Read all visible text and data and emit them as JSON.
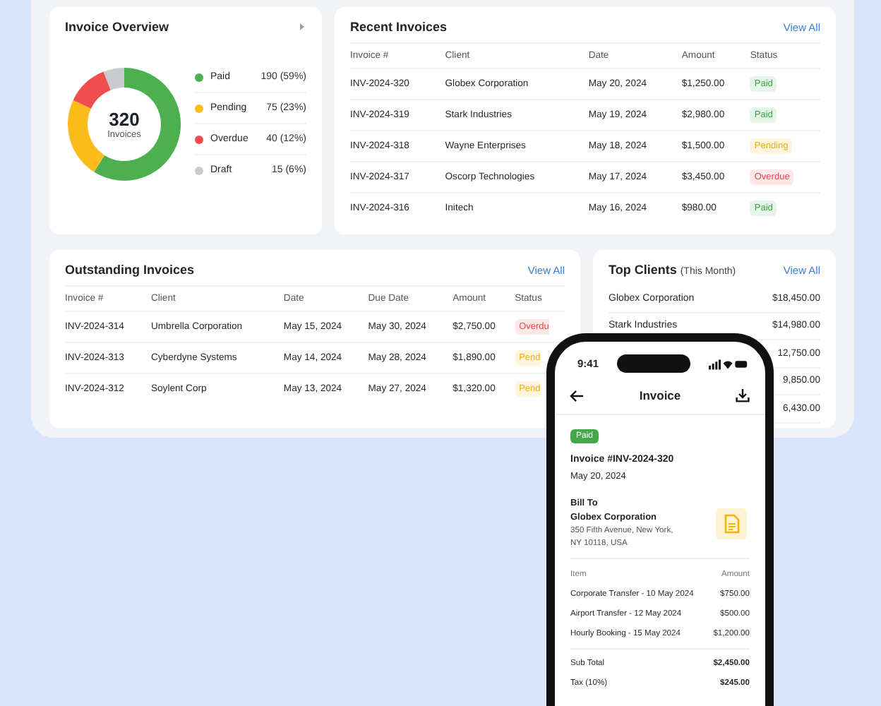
{
  "overview": {
    "title": "Invoice Overview",
    "total": "320",
    "total_label": "Invoices",
    "legend": [
      {
        "value": "190 (59%)",
        "color": "#4caf50"
      },
      {
        "value": "75 (23%)",
        "color": "#fbbc1a"
      },
      {
        "value": "40 (12%)",
        "color": "#f04e4e"
      },
      {
        "value": "15 (6%)",
        "color": "#c8cacd"
      }
    ],
    "chart_data": {
      "type": "donut",
      "categories": [
        "Paid",
        "Pending",
        "Overdue",
        "Draft"
      ],
      "values": [
        59,
        23,
        12,
        6
      ]
    }
  },
  "recent": {
    "title": "Recent Invoices",
    "link": "View All",
    "columns": [
      "Invoice #",
      "Client",
      "Date",
      "Amount",
      "Status"
    ],
    "rows": [
      {
        "invoice": "INV-2024-320",
        "client": "Globex Corporation",
        "date": "May 20, 2024",
        "amount": "$1,250.00",
        "status": {
          "label": "Paid",
          "kind": "paid"
        }
      },
      {
        "invoice": "INV-2024-319",
        "client": "Stark Industries",
        "date": "May 19, 2024",
        "amount": "$2,980.00",
        "status": {
          "label": "Paid",
          "kind": "paid"
        }
      },
      {
        "invoice": "INV-2024-318",
        "client": "Wayne Enterprises",
        "date": "May 18, 2024",
        "amount": "$1,500.00",
        "status": {
          "label": "Pending",
          "kind": "pending"
        }
      },
      {
        "invoice": "INV-2024-317",
        "client": "Oscorp Technologies",
        "date": "May 17, 2024",
        "amount": "$3,450.00",
        "status": {
          "label": "Overdue",
          "kind": "overdue"
        }
      },
      {
        "invoice": "INV-2024-316",
        "client": "Initech",
        "date": "May 16, 2024",
        "amount": "$980.00",
        "status": {
          "label": "Paid",
          "kind": "paid"
        }
      }
    ]
  },
  "outstanding": {
    "title": "Outstanding Invoices",
    "link": "View All",
    "columns": [
      "Invoice #",
      "Client",
      "Date",
      "Due Date",
      "Amount",
      "Status"
    ],
    "rows": [
      {
        "invoice": "INV-2024-314",
        "client": "Umbrella Corporation",
        "date": "May 15, 2024",
        "due": "May 30, 2024",
        "amount": "$2,750.00",
        "status": {
          "label": "Overdu",
          "kind": "overdue"
        }
      },
      {
        "invoice": "INV-2024-313",
        "client": "Cyberdyne Systems",
        "date": "May 14, 2024",
        "due": "May 28, 2024",
        "amount": "$1,890.00",
        "status": {
          "label": "Pend",
          "kind": "pending"
        }
      },
      {
        "invoice": "INV-2024-312",
        "client": "Soylent Corp",
        "date": "May 13, 2024",
        "due": "May 27, 2024",
        "amount": "$1,320.00",
        "status": {
          "label": "Pend",
          "kind": "pending"
        }
      }
    ]
  },
  "top_clients": {
    "title": "Top Clients",
    "subtitle": "(This Month)",
    "link": "View All",
    "rows": [
      {
        "name": "Globex Corporation",
        "amount": "$18,450.00"
      },
      {
        "name": "Stark Industries",
        "amount": "$14,980.00"
      },
      {
        "amount": "12,750.00"
      },
      {
        "amount": "9,850.00"
      },
      {
        "amount": "6,430.00"
      }
    ]
  },
  "phone": {
    "time": "9:41",
    "title": "Invoice",
    "status": {
      "label": "Paid",
      "kind": "paid"
    },
    "invoice_no": "Invoice #INV-2024-320",
    "date": "May 20, 2024",
    "bill_to": "Bill To",
    "client": "Globex Corporation",
    "address": [
      "350 Fifth Avenue, New York,",
      "NY 10118, USA"
    ],
    "columns": [
      "Item",
      "Amount"
    ],
    "items": [
      {
        "name": "Corporate Transfer - 10 May 2024",
        "amount": "$750.00"
      },
      {
        "name": "Airport Transfer - 12 May 2024",
        "amount": "$500.00"
      },
      {
        "name": "Hourly Booking - 15 May 2024",
        "amount": "$1,200.00"
      }
    ],
    "totals": [
      {
        "label": "Sub Total",
        "amount": "$2,450.00"
      },
      {
        "label": "Tax (10%)",
        "amount": "$245.00"
      }
    ]
  }
}
